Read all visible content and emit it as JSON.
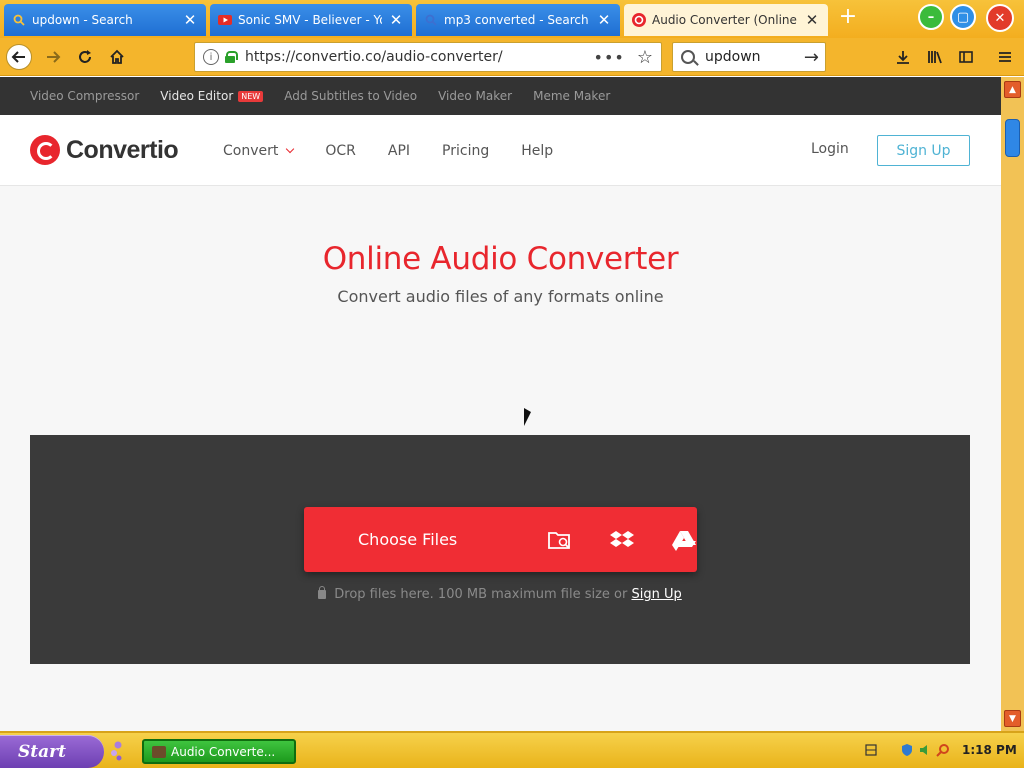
{
  "browser": {
    "tabs": [
      {
        "title": "updown - Search",
        "icon": "search-icon"
      },
      {
        "title": "Sonic SMV - Believer - Yo",
        "icon": "youtube-icon"
      },
      {
        "title": "mp3 converted - Search",
        "icon": "search-icon"
      },
      {
        "title": "Audio Converter (Online",
        "icon": "convertio-icon",
        "active": true
      }
    ],
    "new_tab": "+",
    "url": "https://convertio.co/audio-converter/",
    "page_actions": "•••",
    "search_query": "updown"
  },
  "promo_bar": {
    "items": [
      "Video Compressor",
      "Video Editor",
      "Add Subtitles to Video",
      "Video Maker",
      "Meme Maker"
    ],
    "badge": "NEW"
  },
  "header": {
    "logo": "Convertio",
    "nav": [
      "Convert",
      "OCR",
      "API",
      "Pricing",
      "Help"
    ],
    "login": "Login",
    "signup": "Sign Up"
  },
  "hero": {
    "title": "Online Audio Converter",
    "subtitle": "Convert audio files of any formats online"
  },
  "dropzone": {
    "button": "Choose Files",
    "note": "Drop files here. 100 MB maximum file size or",
    "note_link": "Sign Up"
  },
  "taskbar": {
    "start": "Start",
    "task": "Audio Converte...",
    "clock": "1:18 PM"
  },
  "colors": {
    "brand_red": "#e8262d",
    "button_red": "#f02d34",
    "signup_blue": "#4fb3d4",
    "chrome_orange": "#f4b52c"
  }
}
